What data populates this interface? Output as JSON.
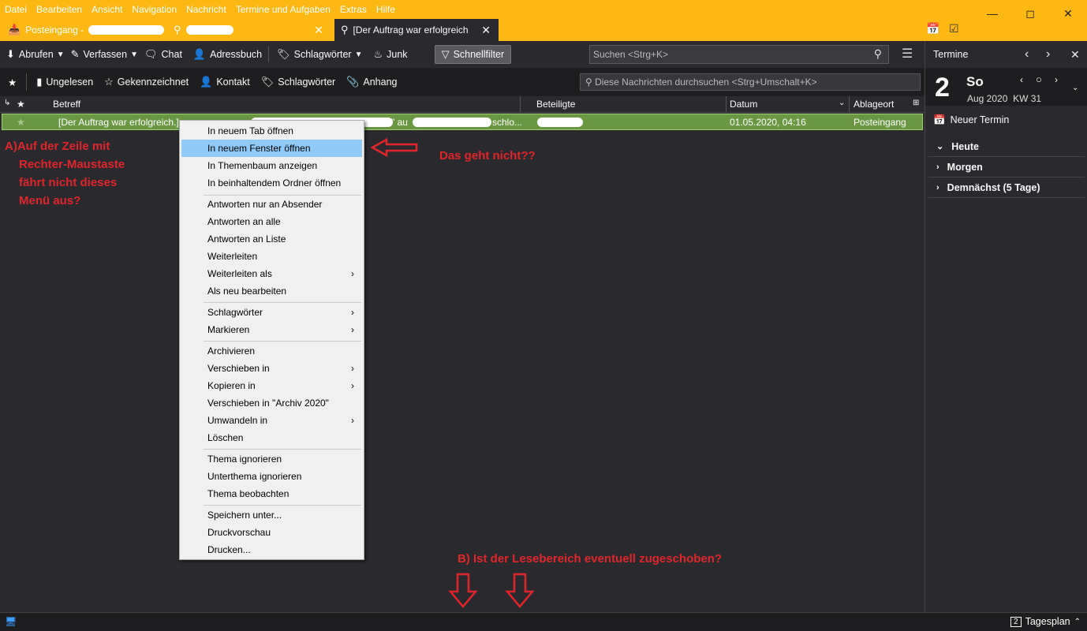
{
  "menubar": [
    "Datei",
    "Bearbeiten",
    "Ansicht",
    "Navigation",
    "Nachricht",
    "Termine und Aufgaben",
    "Extras",
    "Hilfe"
  ],
  "tabs": [
    {
      "label": "Posteingang -",
      "icon": "inbox-icon"
    },
    {
      "label": "",
      "icon": "search-icon"
    },
    {
      "label": "[Der Auftrag war erfolgreich",
      "icon": "search-icon"
    }
  ],
  "toolbar": {
    "get_messages": "Abrufen",
    "write": "Verfassen",
    "chat": "Chat",
    "address_book": "Adressbuch",
    "tags": "Schlagwörter",
    "junk": "Junk",
    "quick_filter": "Schnellfilter",
    "search_placeholder": "Suchen <Strg+K>"
  },
  "filterbar": {
    "unread": "Ungelesen",
    "starred": "Gekennzeichnet",
    "contact": "Kontakt",
    "tags": "Schlagwörter",
    "attachment": "Anhang",
    "search_placeholder": "Diese Nachrichten durchsuchen <Strg+Umschalt+K>"
  },
  "columns": {
    "subject": "Betreff",
    "participants": "Beteiligte",
    "date": "Datum",
    "folder": "Ablageort"
  },
  "message_row": {
    "subject": "[Der Auftrag war erfolgreich.]",
    "subject_tail": "\" au",
    "subject_end": "schlo...",
    "date": "01.05.2020, 04:16",
    "folder": "Posteingang"
  },
  "context_menu": {
    "groups": [
      [
        "In neuem Tab öffnen",
        "In neuem Fenster öffnen",
        "In Themenbaum anzeigen",
        "In beinhaltendem Ordner öffnen"
      ],
      [
        "Antworten nur an Absender",
        "Antworten an alle",
        "Antworten an Liste",
        "Weiterleiten",
        "Weiterleiten als",
        "Als neu bearbeiten"
      ],
      [
        "Schlagwörter",
        "Markieren"
      ],
      [
        "Archivieren",
        "Verschieben in",
        "Kopieren in",
        "Verschieben in \"Archiv 2020\"",
        "Umwandeln in",
        "Löschen"
      ],
      [
        "Thema ignorieren",
        "Unterthema ignorieren",
        "Thema beobachten"
      ],
      [
        "Speichern unter...",
        "Druckvorschau",
        "Drucken..."
      ]
    ],
    "highlighted": "In neuem Fenster öffnen"
  },
  "annotations": {
    "a_lines": [
      "A)Auf der Zeile mit",
      "Rechter-Maustaste",
      "fährt nicht dieses",
      "Menü aus?"
    ],
    "middle": "Das geht nicht??",
    "b": "B) Ist der Lesebereich eventuell zugeschoben?",
    "color": "#e0262b"
  },
  "calendar_pane": {
    "title": "Termine",
    "day_number": "2",
    "day_name": "So",
    "month_year": "Aug 2020",
    "week": "KW 31",
    "new_event": "Neuer Termin",
    "agenda": [
      "Heute",
      "Morgen",
      "Demnächst (5 Tage)"
    ]
  },
  "statusbar": {
    "today_pane_label": "Tagesplan",
    "today_pane_day": "2"
  },
  "colors": {
    "titlebar": "#fdb813",
    "selected_row": "#6a9744",
    "menu_highlight": "#91c9f7"
  }
}
